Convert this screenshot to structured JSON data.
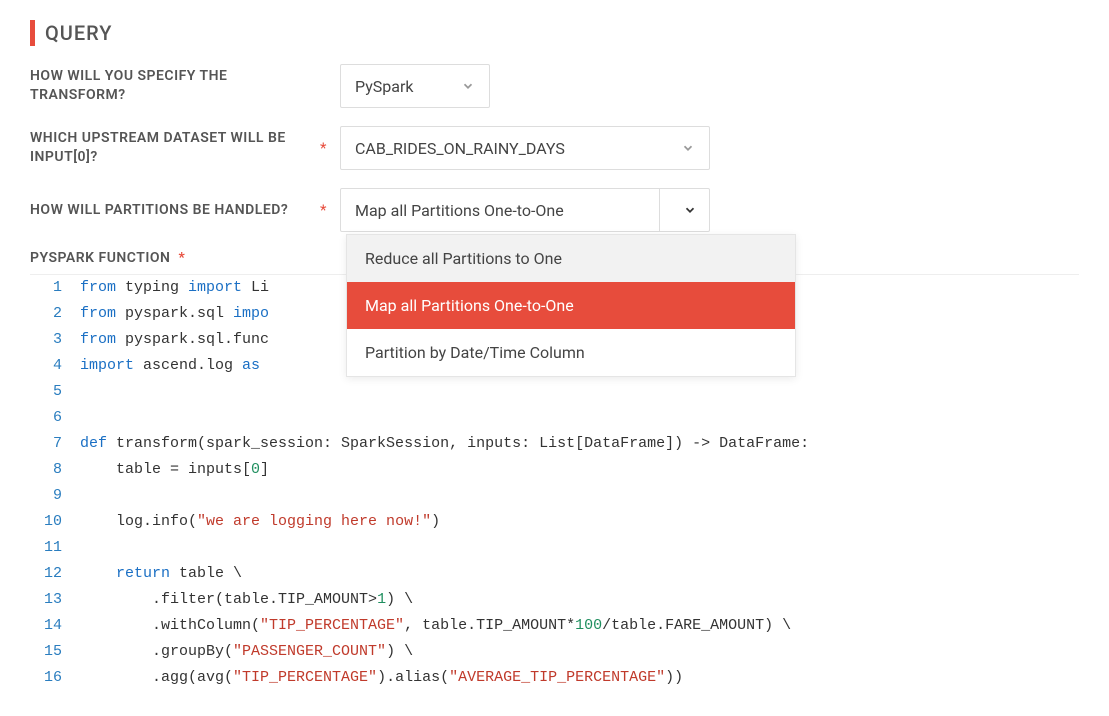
{
  "section_title": "QUERY",
  "fields": {
    "transform_spec": {
      "label": "HOW WILL YOU SPECIFY THE TRANSFORM?",
      "required": false,
      "value": "PySpark"
    },
    "upstream_input": {
      "label": "WHICH UPSTREAM DATASET WILL BE INPUT[0]?",
      "required": true,
      "value": "CAB_RIDES_ON_RAINY_DAYS"
    },
    "partition_handling": {
      "label": "HOW WILL PARTITIONS BE HANDLED?",
      "required": true,
      "value": "Map all Partitions One-to-One",
      "options": [
        "Reduce all Partitions to One",
        "Map all Partitions One-to-One",
        "Partition by Date/Time Column"
      ]
    },
    "pyspark_function": {
      "label": "PYSPARK FUNCTION",
      "required": true
    }
  },
  "code": {
    "lines": [
      {
        "n": 1,
        "tokens": [
          {
            "t": "from ",
            "c": "kw"
          },
          {
            "t": "typing "
          },
          {
            "t": "import ",
            "c": "kw"
          },
          {
            "t": "Li"
          }
        ]
      },
      {
        "n": 2,
        "tokens": [
          {
            "t": "from ",
            "c": "kw"
          },
          {
            "t": "pyspark.sql "
          },
          {
            "t": "impo",
            "c": "kw"
          }
        ]
      },
      {
        "n": 3,
        "tokens": [
          {
            "t": "from ",
            "c": "kw"
          },
          {
            "t": "pyspark.sql.func"
          }
        ]
      },
      {
        "n": 4,
        "tokens": [
          {
            "t": "import ",
            "c": "kw"
          },
          {
            "t": "ascend.log "
          },
          {
            "t": "as ",
            "c": "kw"
          }
        ]
      },
      {
        "n": 5,
        "tokens": []
      },
      {
        "n": 6,
        "tokens": []
      },
      {
        "n": 7,
        "tokens": [
          {
            "t": "def ",
            "c": "kw"
          },
          {
            "t": "transform(spark_session: SparkSession, inputs: List[DataFrame]) -> DataFrame:"
          }
        ]
      },
      {
        "n": 8,
        "tokens": [
          {
            "t": "    table = inputs["
          },
          {
            "t": "0",
            "c": "num"
          },
          {
            "t": "]"
          }
        ]
      },
      {
        "n": 9,
        "tokens": []
      },
      {
        "n": 10,
        "tokens": [
          {
            "t": "    log.info("
          },
          {
            "t": "\"we are logging here now!\"",
            "c": "str"
          },
          {
            "t": ")"
          }
        ]
      },
      {
        "n": 11,
        "tokens": []
      },
      {
        "n": 12,
        "tokens": [
          {
            "t": "    "
          },
          {
            "t": "return ",
            "c": "kw"
          },
          {
            "t": "table \\"
          }
        ]
      },
      {
        "n": 13,
        "tokens": [
          {
            "t": "        .filter(table.TIP_AMOUNT>"
          },
          {
            "t": "1",
            "c": "num"
          },
          {
            "t": ") \\"
          }
        ]
      },
      {
        "n": 14,
        "tokens": [
          {
            "t": "        .withColumn("
          },
          {
            "t": "\"TIP_PERCENTAGE\"",
            "c": "str"
          },
          {
            "t": ", table.TIP_AMOUNT*"
          },
          {
            "t": "100",
            "c": "num"
          },
          {
            "t": "/table.FARE_AMOUNT) \\"
          }
        ]
      },
      {
        "n": 15,
        "tokens": [
          {
            "t": "        .groupBy("
          },
          {
            "t": "\"PASSENGER_COUNT\"",
            "c": "str"
          },
          {
            "t": ") \\"
          }
        ]
      },
      {
        "n": 16,
        "tokens": [
          {
            "t": "        .agg(avg("
          },
          {
            "t": "\"TIP_PERCENTAGE\"",
            "c": "str"
          },
          {
            "t": ").alias("
          },
          {
            "t": "\"AVERAGE_TIP_PERCENTAGE\"",
            "c": "str"
          },
          {
            "t": "))"
          }
        ]
      }
    ]
  }
}
